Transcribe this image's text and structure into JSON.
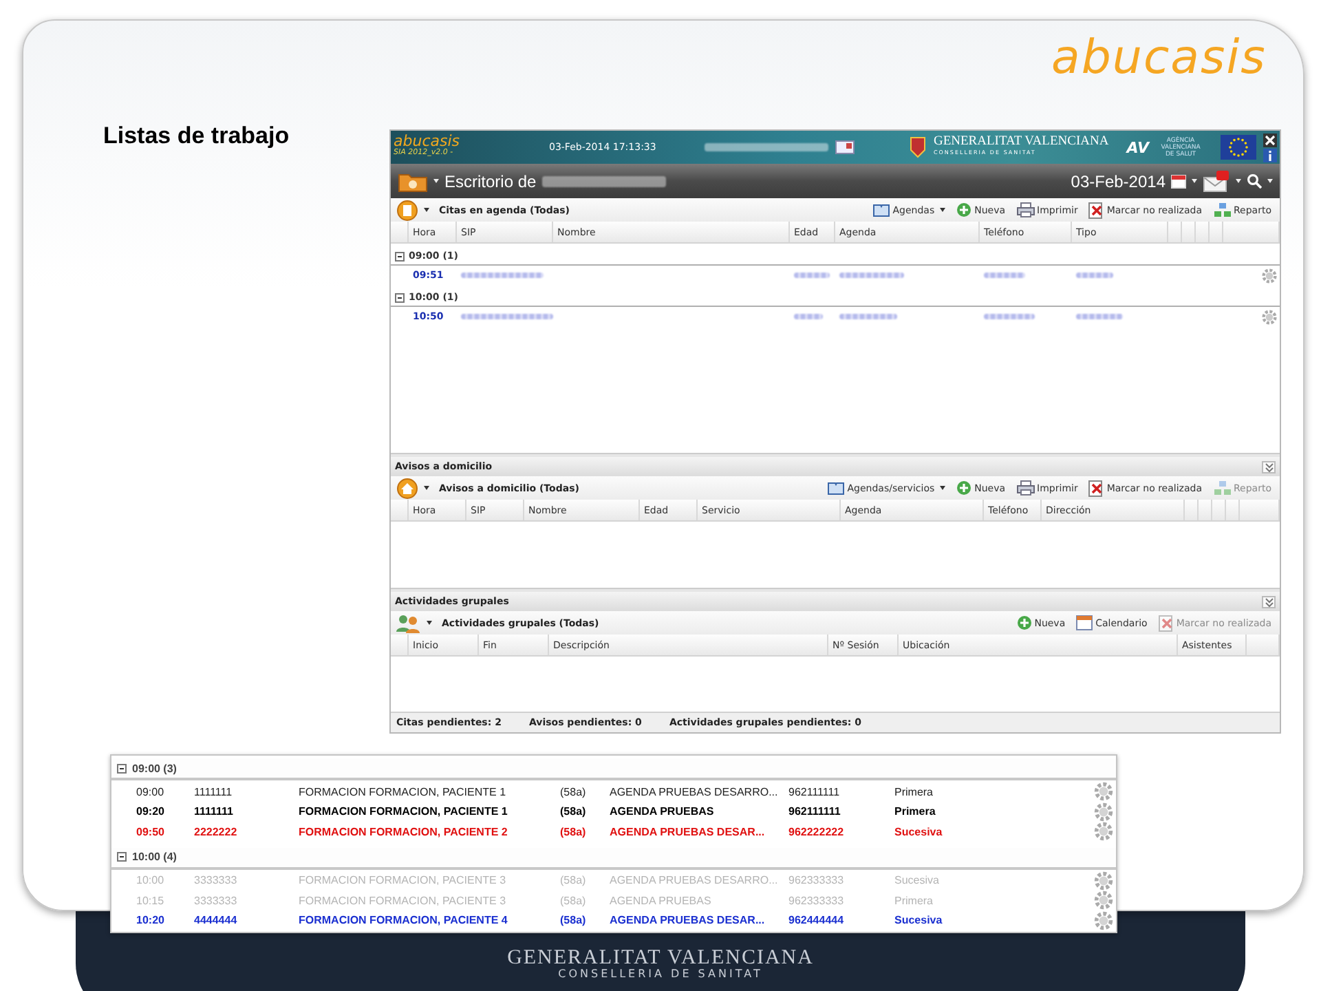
{
  "slide": {
    "title": "Listas de trabajo",
    "logo": "abucasis",
    "footer_line_1": "GENERALITAT VALENCIANA",
    "footer_line_2": "CONSELLERIA DE SANITAT"
  },
  "app": {
    "header": {
      "logo": "abucasis",
      "version": "SIA 2012_v2.0 -",
      "datetime": "03-Feb-2014 17:13:33",
      "org": "GENERALITAT VALENCIANA",
      "org_sub": "CONSELLERIA DE SANITAT",
      "agency_mark": "AV",
      "agency": "AGÈNCIA VALENCIANA DE SALUT"
    },
    "desk_title": "Escritorio de",
    "date": "03-Feb-2014",
    "panels": [
      {
        "title": "Citas en agenda (Todas)",
        "actions": [
          {
            "label": "Agendas",
            "kind": "book",
            "dropdown": true,
            "disabled": false
          },
          {
            "label": "Nueva",
            "kind": "add",
            "dropdown": false,
            "disabled": false
          },
          {
            "label": "Imprimir",
            "kind": "print",
            "dropdown": false,
            "disabled": false
          },
          {
            "label": "Marcar no realizada",
            "kind": "cancel",
            "dropdown": false,
            "disabled": false
          },
          {
            "label": "Reparto",
            "kind": "share",
            "dropdown": false,
            "disabled": false
          }
        ],
        "columns": [
          "Hora",
          "SIP",
          "Nombre",
          "Edad",
          "Agenda",
          "Teléfono",
          "Tipo"
        ],
        "groups": [
          {
            "label": "09:00 (1)",
            "rows": [
              {
                "time": "09:51"
              }
            ]
          },
          {
            "label": "10:00 (1)",
            "rows": [
              {
                "time": "10:50"
              }
            ]
          }
        ]
      },
      {
        "section": "Avisos a domicilio",
        "title": "Avisos a domicilio (Todas)",
        "actions": [
          {
            "label": "Agendas/servicios",
            "kind": "book",
            "dropdown": true,
            "disabled": false
          },
          {
            "label": "Nueva",
            "kind": "add",
            "dropdown": false,
            "disabled": false
          },
          {
            "label": "Imprimir",
            "kind": "print",
            "dropdown": false,
            "disabled": false
          },
          {
            "label": "Marcar no realizada",
            "kind": "cancel",
            "dropdown": false,
            "disabled": false
          },
          {
            "label": "Reparto",
            "kind": "share",
            "dropdown": false,
            "disabled": true
          }
        ],
        "columns": [
          "Hora",
          "SIP",
          "Nombre",
          "Edad",
          "Servicio",
          "Agenda",
          "Teléfono",
          "Dirección"
        ]
      },
      {
        "section": "Actividades grupales",
        "title": "Actividades grupales (Todas)",
        "actions": [
          {
            "label": "Nueva",
            "kind": "add",
            "dropdown": false,
            "disabled": false
          },
          {
            "label": "Calendario",
            "kind": "calendar",
            "dropdown": false,
            "disabled": false
          },
          {
            "label": "Marcar no realizada",
            "kind": "cancel",
            "dropdown": false,
            "disabled": true
          }
        ],
        "columns": [
          "Inicio",
          "Fin",
          "Descripción",
          "Nº Sesión",
          "Ubicación",
          "Asistentes"
        ]
      }
    ],
    "status": [
      "Citas pendientes: 2",
      "Avisos pendientes: 0",
      "Actividades grupales pendientes: 0"
    ]
  },
  "detail": {
    "groups": [
      {
        "label": "09:00 (3)",
        "rows": [
          {
            "kind": "normal",
            "cells": [
              "09:00",
              "1111111",
              "FORMACION FORMACION, PACIENTE 1",
              "(58a)",
              "AGENDA PRUEBAS DESARRO...",
              "962111111",
              "Primera"
            ]
          },
          {
            "kind": "bold",
            "cells": [
              "09:20",
              "1111111",
              "FORMACION FORMACION, PACIENTE 1",
              "(58a)",
              "AGENDA PRUEBAS",
              "962111111",
              "Primera"
            ]
          },
          {
            "kind": "red",
            "cells": [
              "09:50",
              "2222222",
              "FORMACION FORMACION, PACIENTE 2",
              "(58a)",
              "AGENDA PRUEBAS DESAR...",
              "962222222",
              "Sucesiva"
            ]
          }
        ]
      },
      {
        "label": "10:00 (4)",
        "rows": [
          {
            "kind": "grey",
            "cells": [
              "10:00",
              "3333333",
              "FORMACION FORMACION, PACIENTE 3",
              "(58a)",
              "AGENDA PRUEBAS DESARRO...",
              "962333333",
              "Sucesiva"
            ]
          },
          {
            "kind": "grey",
            "cells": [
              "10:15",
              "3333333",
              "FORMACION FORMACION, PACIENTE 3",
              "(58a)",
              "AGENDA PRUEBAS",
              "962333333",
              "Primera"
            ]
          },
          {
            "kind": "blue",
            "cells": [
              "10:20",
              "4444444",
              "FORMACION FORMACION, PACIENTE 4",
              "(58a)",
              "AGENDA PRUEBAS DESAR...",
              "962444444",
              "Sucesiva"
            ]
          }
        ]
      }
    ]
  }
}
